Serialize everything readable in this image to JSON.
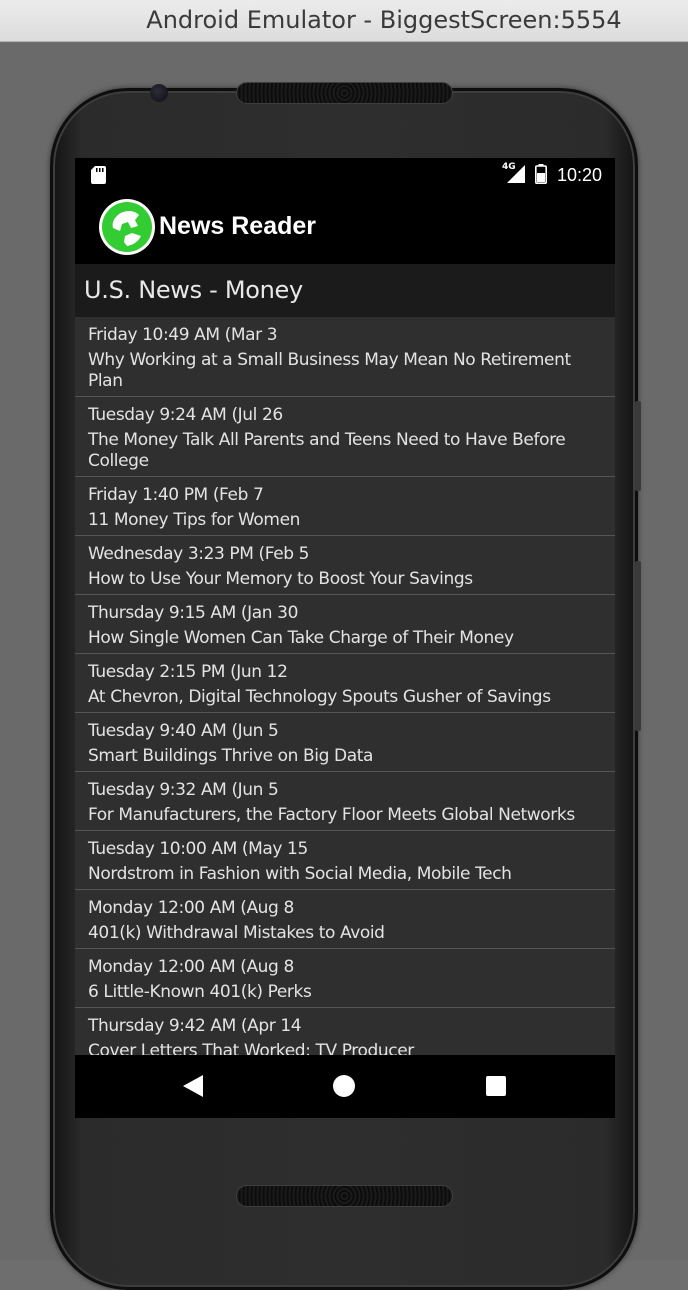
{
  "window": {
    "title": "Android Emulator - BiggestScreen:5554"
  },
  "statusbar": {
    "network": "4G",
    "time": "10:20",
    "sd_icon": "sd-card-icon",
    "signal_icon": "signal-icon",
    "battery_icon": "battery-icon"
  },
  "app": {
    "title": "News Reader",
    "logo_icon": "globe-icon",
    "logo_color": "#33cc33"
  },
  "section": {
    "title": "U.S. News - Money"
  },
  "news": [
    {
      "date": "Friday 10:49 AM (Mar 3",
      "headline": "Why Working at a Small Business May Mean No Retirement Plan"
    },
    {
      "date": "Tuesday 9:24 AM (Jul 26",
      "headline": "The Money Talk All Parents and Teens Need to Have Before College"
    },
    {
      "date": "Friday 1:40 PM (Feb 7",
      "headline": "11 Money Tips for Women"
    },
    {
      "date": "Wednesday 3:23 PM (Feb 5",
      "headline": "How to Use Your Memory to Boost Your Savings"
    },
    {
      "date": "Thursday 9:15 AM (Jan 30",
      "headline": "How Single Women Can Take Charge of Their Money"
    },
    {
      "date": "Tuesday 2:15 PM (Jun 12",
      "headline": "At Chevron, Digital Technology Spouts Gusher of Savings"
    },
    {
      "date": "Tuesday 9:40 AM (Jun 5",
      "headline": "Smart Buildings Thrive on Big Data"
    },
    {
      "date": "Tuesday 9:32 AM (Jun 5",
      "headline": "For Manufacturers, the Factory Floor Meets Global Networks"
    },
    {
      "date": "Tuesday 10:00 AM (May 15",
      "headline": "Nordstrom in Fashion with Social Media, Mobile Tech"
    },
    {
      "date": "Monday 12:00 AM (Aug 8",
      "headline": "401(k) Withdrawal Mistakes to Avoid"
    },
    {
      "date": "Monday 12:00 AM (Aug 8",
      "headline": "6 Little-Known 401(k) Perks"
    },
    {
      "date": "Thursday 9:42 AM (Apr 14",
      "headline": "Cover Letters That Worked: TV Producer"
    }
  ],
  "navbar": {
    "back_icon": "back-triangle-icon",
    "home_icon": "home-circle-icon",
    "recents_icon": "recents-square-icon"
  }
}
